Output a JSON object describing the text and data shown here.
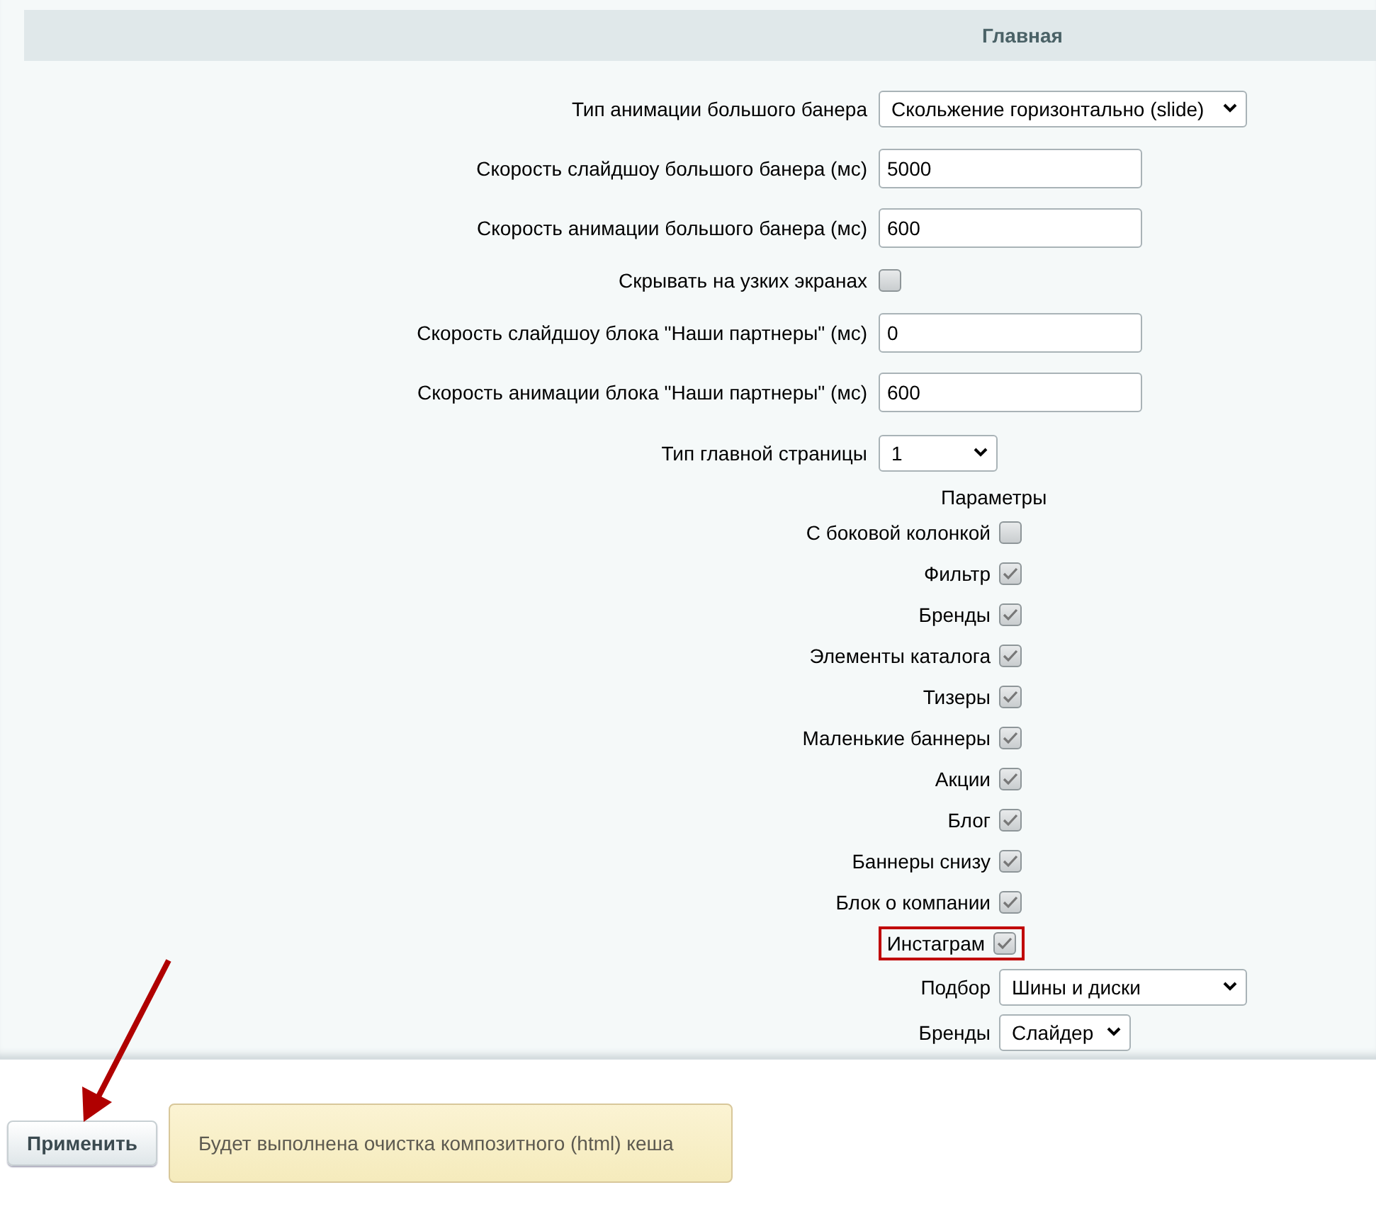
{
  "section": {
    "title": "Главная"
  },
  "rows": [
    {
      "kind": "select",
      "label": "Тип анимации большого банера",
      "value": "Скольжение горизонтально (slide)"
    },
    {
      "kind": "input",
      "label": "Скорость слайдшоу большого банера (мс)",
      "value": "5000"
    },
    {
      "kind": "input",
      "label": "Скорость анимации большого банера (мс)",
      "value": "600"
    },
    {
      "kind": "checkbox",
      "label": "Скрывать на узких экранах",
      "checked": false,
      "highlighted": false
    },
    {
      "kind": "input",
      "label": "Скорость слайдшоу блока \"Наши партнеры\" (мс)",
      "value": "0"
    },
    {
      "kind": "input",
      "label": "Скорость анимации блока \"Наши партнеры\" (мс)",
      "value": "600"
    },
    {
      "kind": "select",
      "label": "Тип главной страницы",
      "value": "1"
    },
    {
      "kind": "heading",
      "label": "Параметры"
    },
    {
      "kind": "checkbox",
      "label": "С боковой колонкой",
      "checked": false,
      "highlighted": false
    },
    {
      "kind": "checkbox",
      "label": "Фильтр",
      "checked": true,
      "highlighted": false
    },
    {
      "kind": "checkbox",
      "label": "Бренды",
      "checked": true,
      "highlighted": false
    },
    {
      "kind": "checkbox",
      "label": "Элементы каталога",
      "checked": true,
      "highlighted": false
    },
    {
      "kind": "checkbox",
      "label": "Тизеры",
      "checked": true,
      "highlighted": false
    },
    {
      "kind": "checkbox",
      "label": "Маленькие баннеры",
      "checked": true,
      "highlighted": false
    },
    {
      "kind": "checkbox",
      "label": "Акции",
      "checked": true,
      "highlighted": false
    },
    {
      "kind": "checkbox",
      "label": "Блог",
      "checked": true,
      "highlighted": false
    },
    {
      "kind": "checkbox",
      "label": "Баннеры снизу",
      "checked": true,
      "highlighted": false
    },
    {
      "kind": "checkbox",
      "label": "Блок о компании",
      "checked": true,
      "highlighted": false
    },
    {
      "kind": "checkbox",
      "label": "Инстаграм",
      "checked": true,
      "highlighted": true
    },
    {
      "kind": "select",
      "label": "Подбор",
      "value": "Шины и диски"
    },
    {
      "kind": "select",
      "label": "Бренды",
      "value": "Слайдер"
    }
  ],
  "apply_button": "Применить",
  "notice": "Будет выполнена очистка композитного (html) кеша"
}
